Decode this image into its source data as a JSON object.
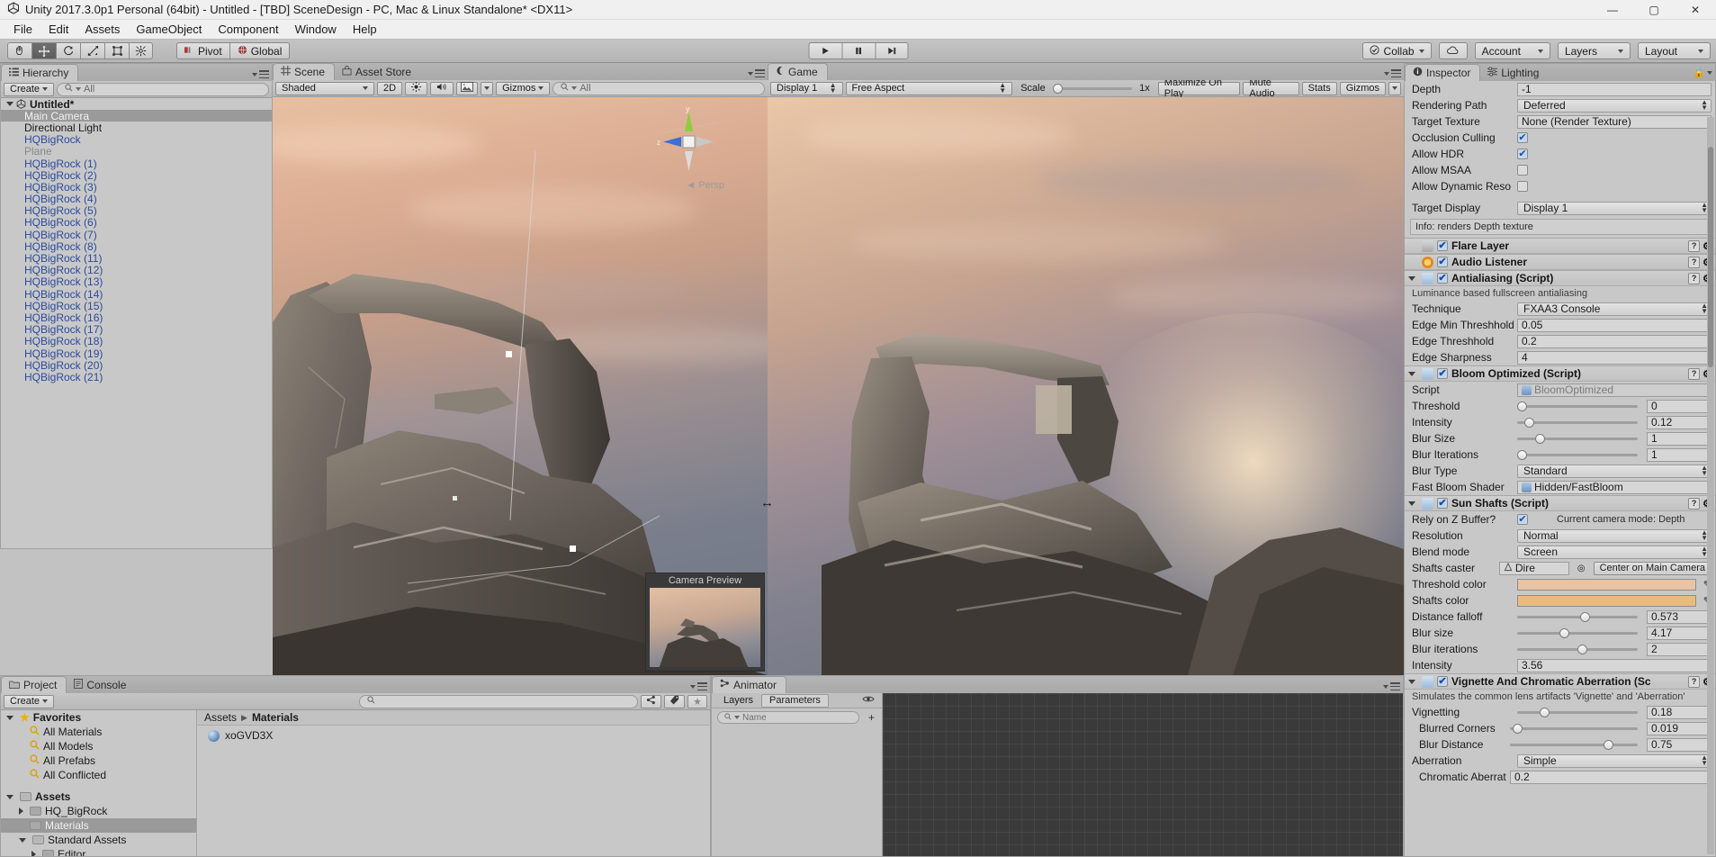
{
  "window": {
    "title": "Unity 2017.3.0p1 Personal (64bit) - Untitled - [TBD] SceneDesign - PC, Mac & Linux Standalone* <DX11>",
    "minimize": "—",
    "maximize": "▢",
    "close": "✕"
  },
  "menu": {
    "items": [
      "File",
      "Edit",
      "Assets",
      "GameObject",
      "Component",
      "Window",
      "Help"
    ]
  },
  "toolbar": {
    "tools": [
      "hand-tool",
      "move-tool",
      "rotate-tool",
      "scale-tool",
      "rect-tool",
      "transform-tool"
    ],
    "pivot": "Pivot",
    "global": "Global",
    "play": "▶",
    "pause": "❚❚",
    "step": "▶❚",
    "collab": "Collab",
    "cloud": "cloud-icon",
    "account": "Account",
    "layers": "Layers",
    "layout": "Layout"
  },
  "hierarchy": {
    "tab": "Hierarchy",
    "create": "Create",
    "search_placeholder": "All",
    "root": "Untitled*",
    "items": [
      {
        "label": "Main Camera",
        "style": "sel"
      },
      {
        "label": "Directional Light",
        "style": "normal"
      },
      {
        "label": "HQBigRock",
        "style": "prefab"
      },
      {
        "label": "Plane",
        "style": "inactive"
      },
      {
        "label": "HQBigRock (1)",
        "style": "prefab"
      },
      {
        "label": "HQBigRock (2)",
        "style": "prefab"
      },
      {
        "label": "HQBigRock (3)",
        "style": "prefab"
      },
      {
        "label": "HQBigRock (4)",
        "style": "prefab"
      },
      {
        "label": "HQBigRock (5)",
        "style": "prefab"
      },
      {
        "label": "HQBigRock (6)",
        "style": "prefab"
      },
      {
        "label": "HQBigRock (7)",
        "style": "prefab"
      },
      {
        "label": "HQBigRock (8)",
        "style": "prefab"
      },
      {
        "label": "HQBigRock (11)",
        "style": "prefab"
      },
      {
        "label": "HQBigRock (12)",
        "style": "prefab"
      },
      {
        "label": "HQBigRock (13)",
        "style": "prefab"
      },
      {
        "label": "HQBigRock (14)",
        "style": "prefab"
      },
      {
        "label": "HQBigRock (15)",
        "style": "prefab"
      },
      {
        "label": "HQBigRock (16)",
        "style": "prefab"
      },
      {
        "label": "HQBigRock (17)",
        "style": "prefab"
      },
      {
        "label": "HQBigRock (18)",
        "style": "prefab"
      },
      {
        "label": "HQBigRock (19)",
        "style": "prefab"
      },
      {
        "label": "HQBigRock (20)",
        "style": "prefab"
      },
      {
        "label": "HQBigRock (21)",
        "style": "prefab"
      }
    ]
  },
  "scene": {
    "tab": "Scene",
    "tab2": "Asset Store",
    "draw_mode": "Shaded",
    "two_d": "2D",
    "lighting_icon": "sun-icon",
    "audio_icon": "speaker-icon",
    "fx_icon": "image-icon",
    "gizmos": "Gizmos",
    "search_placeholder": "All",
    "persp": "Persp",
    "gizmo_axes": {
      "y": "y",
      "z": "z"
    },
    "camera_preview": "Camera Preview"
  },
  "game": {
    "tab": "Game",
    "display": "Display 1",
    "aspect": "Free Aspect",
    "scale_label": "Scale",
    "scale_value": "1x",
    "maximize": "Maximize On Play",
    "mute": "Mute Audio",
    "stats": "Stats",
    "gizmos": "Gizmos"
  },
  "inspector": {
    "tab": "Inspector",
    "tab2": "Lighting",
    "lock_icon": "lock-icon",
    "camera_fields": [
      {
        "label": "Depth",
        "type": "field",
        "value": "-1"
      },
      {
        "label": "Rendering Path",
        "type": "dropdown",
        "value": "Deferred"
      },
      {
        "label": "Target Texture",
        "type": "object",
        "value": "None (Render Texture)"
      },
      {
        "label": "Occlusion Culling",
        "type": "checkbox",
        "value": true
      },
      {
        "label": "Allow HDR",
        "type": "checkbox",
        "value": true
      },
      {
        "label": "Allow MSAA",
        "type": "checkbox",
        "value": false
      },
      {
        "label": "Allow Dynamic Reso",
        "type": "checkbox",
        "value": false
      }
    ],
    "target_display": {
      "label": "Target Display",
      "value": "Display 1"
    },
    "info": "Info: renders Depth texture",
    "components": [
      {
        "name": "Flare Layer",
        "icon": "flare",
        "enabled": true,
        "expanded": false,
        "rows": []
      },
      {
        "name": "Audio Listener",
        "icon": "audio",
        "enabled": true,
        "expanded": false,
        "rows": []
      },
      {
        "name": "Antialiasing (Script)",
        "icon": "script",
        "enabled": true,
        "expanded": true,
        "help": "Luminance based fullscreen antialiasing",
        "rows": [
          {
            "label": "Technique",
            "type": "dropdown",
            "value": "FXAA3 Console"
          },
          {
            "label": "Edge Min Threshhold",
            "type": "field",
            "value": "0.05"
          },
          {
            "label": "Edge Threshhold",
            "type": "field",
            "value": "0.2"
          },
          {
            "label": "Edge Sharpness",
            "type": "field",
            "value": "4"
          }
        ]
      },
      {
        "name": "Bloom Optimized (Script)",
        "icon": "script",
        "enabled": true,
        "expanded": true,
        "rows": [
          {
            "label": "Script",
            "type": "object-dim",
            "value": "BloomOptimized"
          },
          {
            "label": "Threshold",
            "type": "slider",
            "value": "0",
            "pos": 0
          },
          {
            "label": "Intensity",
            "type": "slider",
            "value": "0.12",
            "pos": 6
          },
          {
            "label": "Blur Size",
            "type": "slider",
            "value": "1",
            "pos": 15
          },
          {
            "label": "Blur Iterations",
            "type": "slider",
            "value": "1",
            "pos": 0
          },
          {
            "label": "Blur Type",
            "type": "dropdown",
            "value": "Standard"
          },
          {
            "label": "Fast Bloom Shader",
            "type": "object",
            "value": "Hidden/FastBloom"
          }
        ]
      },
      {
        "name": "Sun Shafts (Script)",
        "icon": "script",
        "enabled": true,
        "expanded": true,
        "rows": [
          {
            "label": "Rely on Z Buffer?",
            "type": "checkbox-note",
            "value": true,
            "note": "Current camera mode: Depth"
          },
          {
            "label": "Resolution",
            "type": "dropdown",
            "value": "Normal"
          },
          {
            "label": "Blend mode",
            "type": "dropdown",
            "value": "Screen"
          },
          {
            "label": "Shafts caster",
            "type": "caster",
            "value": "Dire",
            "button": "Center on Main Camera"
          },
          {
            "label": "Threshold color",
            "type": "color",
            "value": "#e8c3a4"
          },
          {
            "label": "Shafts color",
            "type": "color",
            "value": "#e8bc80"
          },
          {
            "label": "Distance falloff",
            "type": "slider",
            "value": "0.573",
            "pos": 52
          },
          {
            "label": "Blur size",
            "type": "slider",
            "value": "4.17",
            "pos": 35
          },
          {
            "label": "Blur iterations",
            "type": "slider",
            "value": "2",
            "pos": 50
          },
          {
            "label": "Intensity",
            "type": "field",
            "value": "3.56"
          }
        ]
      },
      {
        "name": "Vignette And Chromatic Aberration (Sc",
        "icon": "script",
        "enabled": true,
        "expanded": true,
        "help": "Simulates the common lens artifacts 'Vignette' and 'Aberration'",
        "rows": [
          {
            "label": "Vignetting",
            "type": "slider",
            "value": "0.18",
            "pos": 19
          },
          {
            "label": "Blurred Corners",
            "type": "slider",
            "value": "0.019",
            "indent": true,
            "pos": 2
          },
          {
            "label": "Blur Distance",
            "type": "slider",
            "value": "0.75",
            "indent": true,
            "pos": 73
          },
          {
            "label": "Aberration",
            "type": "dropdown",
            "value": "Simple"
          },
          {
            "label": "Chromatic Aberratic",
            "type": "field",
            "value": "0.2",
            "indent": true
          }
        ]
      }
    ]
  },
  "project": {
    "tab": "Project",
    "tab2": "Console",
    "create": "Create",
    "search_placeholder": "",
    "tree": [
      {
        "label": "Favorites",
        "type": "fav-root",
        "indent": 0
      },
      {
        "label": "All Materials",
        "type": "search",
        "indent": 1
      },
      {
        "label": "All Models",
        "type": "search",
        "indent": 1
      },
      {
        "label": "All Prefabs",
        "type": "search",
        "indent": 1
      },
      {
        "label": "All Conflicted",
        "type": "search",
        "indent": 1
      },
      {
        "label": "",
        "type": "spacer",
        "indent": 0
      },
      {
        "label": "Assets",
        "type": "folder-open",
        "indent": 0
      },
      {
        "label": "HQ_BigRock",
        "type": "folder-closed",
        "indent": 1
      },
      {
        "label": "Materials",
        "type": "folder-sel",
        "indent": 1
      },
      {
        "label": "Standard Assets",
        "type": "folder-open",
        "indent": 1
      },
      {
        "label": "Editor",
        "type": "folder-closed",
        "indent": 2
      }
    ],
    "breadcrumb": [
      "Assets",
      "Materials"
    ],
    "assets": [
      {
        "label": "xoGVD3X",
        "icon": "material-sphere"
      }
    ]
  },
  "animator": {
    "tab": "Animator",
    "subtabs": [
      "Layers",
      "Parameters"
    ],
    "selected_subtab": "Parameters",
    "eye_icon": "eye-icon",
    "param_search_placeholder": "Name",
    "add_label": "+"
  },
  "colors": {
    "unity_gray": "#c2c2c2",
    "panel_gray": "#c8c8c8",
    "prefab_blue": "#2c4b9b",
    "selection": "#9a9a9a",
    "checkbox_blue": "#1d4f96"
  }
}
